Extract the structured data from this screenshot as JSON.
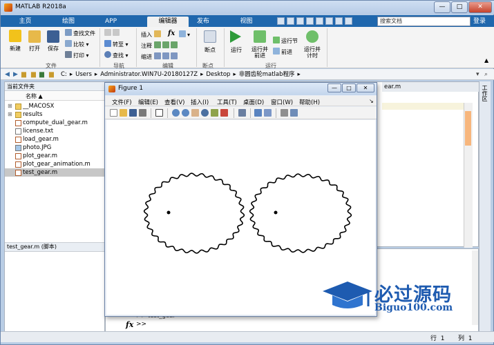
{
  "app": {
    "title": "MATLAB R2018a"
  },
  "window_buttons": {
    "min": "—",
    "max": "□",
    "close": "✕"
  },
  "tabs": [
    {
      "label": "主页"
    },
    {
      "label": "绘图"
    },
    {
      "label": "APP"
    },
    {
      "label": "编辑器",
      "active": true
    },
    {
      "label": "发布"
    },
    {
      "label": "视图"
    }
  ],
  "search": {
    "placeholder": "搜索文档"
  },
  "login": {
    "label": "登录"
  },
  "ribbon": {
    "new": "新建",
    "open": "打开",
    "save": "保存",
    "find_files": "查找文件",
    "compare": "比较",
    "print": "打印",
    "goto": "转至",
    "find": "查找",
    "insert": "插入",
    "comment": "注释",
    "indent": "缩进",
    "fx": "fx",
    "breakpoints": "断点",
    "run": "运行",
    "run_advance": "运行并\n前进",
    "run_section": "运行节",
    "advance": "前进",
    "run_time": "运行并\n计时",
    "groups": {
      "file": "文件",
      "navigate": "导航",
      "edit": "编辑",
      "breakpoints": "断点",
      "run": "运行"
    }
  },
  "address": {
    "segments": [
      "C:",
      "▸",
      "Users",
      "▸",
      "Administrator.WIN7U-20180127Z",
      "▸",
      "Desktop",
      "▸",
      "非圆齿轮matlab程序",
      "▸"
    ]
  },
  "current_folder": {
    "title": "当前文件夹",
    "column": "名称 ▲",
    "files": [
      {
        "name": "__MACOSX",
        "type": "folder",
        "expand": "⊞"
      },
      {
        "name": "results",
        "type": "folder",
        "expand": "⊞"
      },
      {
        "name": "compute_dual_gear.m",
        "type": "m"
      },
      {
        "name": "license.txt",
        "type": "txt"
      },
      {
        "name": "load_gear.m",
        "type": "m"
      },
      {
        "name": "photo.JPG",
        "type": "img"
      },
      {
        "name": "plot_gear.m",
        "type": "m"
      },
      {
        "name": "plot_gear_animation.m",
        "type": "m"
      },
      {
        "name": "test_gear.m",
        "type": "m",
        "selected": true
      }
    ],
    "details": "test_gear.m  (脚本)"
  },
  "editor": {
    "tab": "ear.m"
  },
  "workspace_label": "工作区",
  "command": {
    "history": ">> test_gear",
    "fx": "fx",
    "prompt": ">>"
  },
  "status": {
    "line_label": "行",
    "line": "1",
    "col_label": "列",
    "col": "1"
  },
  "figure": {
    "title": "Figure 1",
    "menus": [
      "文件(F)",
      "编辑(E)",
      "查看(V)",
      "插入(I)",
      "工具(T)",
      "桌面(D)",
      "窗口(W)",
      "帮助(H)"
    ],
    "buttons": {
      "min": "—",
      "max": "□",
      "close": "✕"
    }
  },
  "gears": {
    "teeth": 30,
    "stroke_color": "#000000"
  },
  "watermark": {
    "text": "必过源码",
    "url": "Biguo100.com",
    "color": "#1e5bb0"
  }
}
